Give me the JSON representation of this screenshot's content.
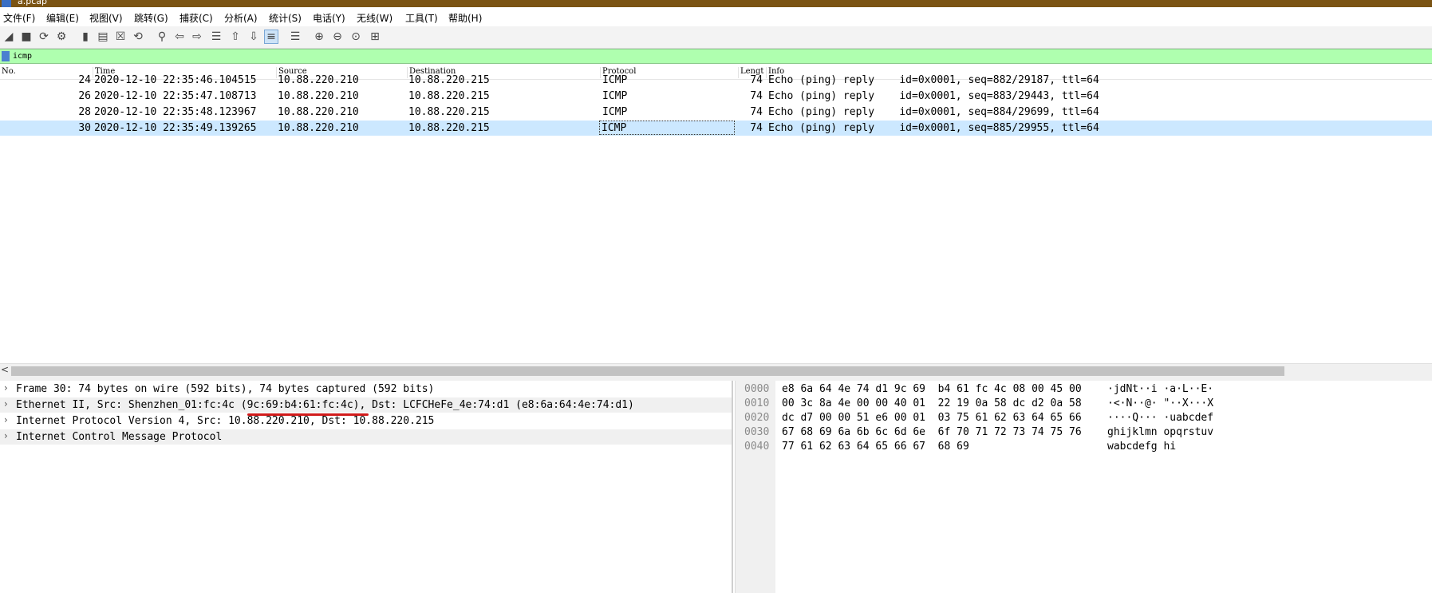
{
  "window": {
    "title": "a.pcap"
  },
  "menu": [
    "文件(F)",
    "编辑(E)",
    "视图(V)",
    "跳转(G)",
    "捕获(C)",
    "分析(A)",
    "统计(S)",
    "电话(Y)",
    "无线(W)",
    "工具(T)",
    "帮助(H)"
  ],
  "toolbar": {
    "icons": [
      "start-capture-icon",
      "stop-capture-icon",
      "restart-capture-icon",
      "capture-options-icon",
      "open-file-icon",
      "save-file-icon",
      "close-file-icon",
      "reload-file-icon",
      "find-packet-icon",
      "go-back-icon",
      "go-forward-icon",
      "go-to-packet-icon",
      "go-first-icon",
      "go-last-icon",
      "auto-scroll-icon",
      "colorize-icon",
      "zoom-in-icon",
      "zoom-out-icon",
      "zoom-normal-icon",
      "resize-columns-icon"
    ]
  },
  "filter": {
    "value": "icmp"
  },
  "columns": {
    "no": "No.",
    "time": "Time",
    "source": "Source",
    "destination": "Destination",
    "protocol": "Protocol",
    "length": "Lengt",
    "info": "Info"
  },
  "packets": [
    {
      "no": "24",
      "time": "2020-12-10 22:35:46.104515",
      "source": "10.88.220.210",
      "destination": "10.88.220.215",
      "protocol": "ICMP",
      "length": "74",
      "info": "Echo (ping) reply    id=0x0001, seq=882/29187, ttl=64"
    },
    {
      "no": "26",
      "time": "2020-12-10 22:35:47.108713",
      "source": "10.88.220.210",
      "destination": "10.88.220.215",
      "protocol": "ICMP",
      "length": "74",
      "info": "Echo (ping) reply    id=0x0001, seq=883/29443, ttl=64"
    },
    {
      "no": "28",
      "time": "2020-12-10 22:35:48.123967",
      "source": "10.88.220.210",
      "destination": "10.88.220.215",
      "protocol": "ICMP",
      "length": "74",
      "info": "Echo (ping) reply    id=0x0001, seq=884/29699, ttl=64"
    },
    {
      "no": "30",
      "time": "2020-12-10 22:35:49.139265",
      "source": "10.88.220.210",
      "destination": "10.88.220.215",
      "protocol": "ICMP",
      "length": "74",
      "info": "Echo (ping) reply    id=0x0001, seq=885/29955, ttl=64"
    }
  ],
  "details": [
    "Frame 30: 74 bytes on wire (592 bits), 74 bytes captured (592 bits)",
    "Ethernet II, Src: Shenzhen_01:fc:4c (9c:69:b4:61:fc:4c), Dst: LCFCHeFe_4e:74:d1 (e8:6a:64:4e:74:d1)",
    "Internet Protocol Version 4, Src: 10.88.220.210, Dst: 10.88.220.215",
    "Internet Control Message Protocol"
  ],
  "bytes": [
    {
      "off": "0000",
      "hex": "e8 6a 64 4e 74 d1 9c 69  b4 61 fc 4c 08 00 45 00",
      "ascii": "·jdNt··i ·a·L··E·"
    },
    {
      "off": "0010",
      "hex": "00 3c 8a 4e 00 00 40 01  22 19 0a 58 dc d2 0a 58",
      "ascii": "·<·N··@· \"··X···X"
    },
    {
      "off": "0020",
      "hex": "dc d7 00 00 51 e6 00 01  03 75 61 62 63 64 65 66",
      "ascii": "····Q··· ·uabcdef"
    },
    {
      "off": "0030",
      "hex": "67 68 69 6a 6b 6c 6d 6e  6f 70 71 72 73 74 75 76",
      "ascii": "ghijklmn opqrstuv"
    },
    {
      "off": "0040",
      "hex": "77 61 62 63 64 65 66 67  68 69",
      "ascii": "wabcdefg hi"
    }
  ],
  "colors": {
    "filter_bg": "#afffaf",
    "selected_row": "#cce8ff",
    "annotation": "#d11b1b",
    "titlebar": "#7b5414"
  }
}
